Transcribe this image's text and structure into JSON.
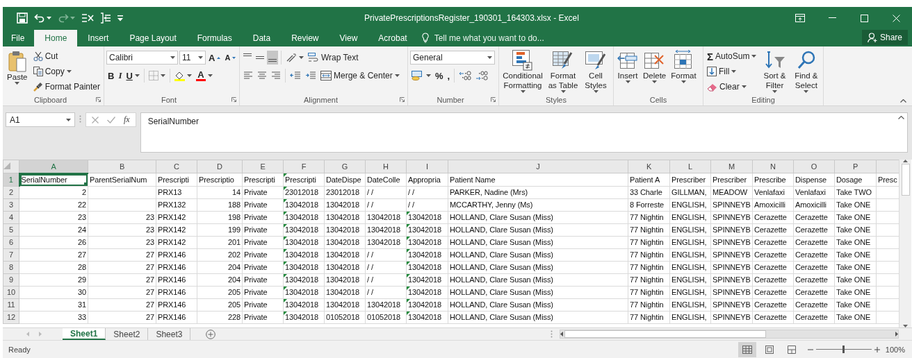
{
  "window": {
    "title": "PrivatePrescriptionsRegister_190301_164303.xlsx - Excel"
  },
  "quick_access": [
    {
      "kind": "save",
      "disabled": false
    },
    {
      "kind": "undo",
      "disabled": false
    },
    {
      "kind": "redo",
      "disabled": true
    },
    {
      "kind": "list-x",
      "disabled": false
    },
    {
      "kind": "list-arrow",
      "disabled": false
    },
    {
      "kind": "customize",
      "disabled": false
    }
  ],
  "tabs": [
    {
      "label": "File",
      "selected": false
    },
    {
      "label": "Home",
      "selected": true
    },
    {
      "label": "Insert",
      "selected": false
    },
    {
      "label": "Page Layout",
      "selected": false
    },
    {
      "label": "Formulas",
      "selected": false
    },
    {
      "label": "Data",
      "selected": false
    },
    {
      "label": "Review",
      "selected": false
    },
    {
      "label": "View",
      "selected": false
    },
    {
      "label": "Acrobat",
      "selected": false
    }
  ],
  "tell_me": {
    "placeholder": "Tell me what you want to do..."
  },
  "share_button": "Share",
  "ribbon": {
    "groups": [
      {
        "kind": "clipboard",
        "label": "Clipboard",
        "launcher": true,
        "paste": "Paste",
        "cut": "Cut",
        "copy": "Copy",
        "format_painter": "Format Painter"
      },
      {
        "kind": "font",
        "label": "Font",
        "launcher": true,
        "font_name": "Calibri",
        "font_size": "11",
        "grow": "A",
        "shrink": "A",
        "bold": "B",
        "italic": "I",
        "underline": "U",
        "font_color": "A"
      },
      {
        "kind": "alignment",
        "label": "Alignment",
        "launcher": true,
        "vertical": [
          {
            "kind": "top",
            "selected": false
          },
          {
            "kind": "middle",
            "selected": false
          },
          {
            "kind": "bottom",
            "selected": true
          }
        ],
        "wrap_text": "Wrap Text",
        "merge_center": "Merge & Center"
      },
      {
        "kind": "number",
        "label": "Number",
        "launcher": true,
        "format": "General",
        "percent": "%",
        "comma": ","
      },
      {
        "kind": "styles",
        "label": "Styles",
        "launcher": false,
        "buttons": [
          {
            "kind": "conditional",
            "label": "Conditional Formatting"
          },
          {
            "kind": "table",
            "label": "Format as Table"
          },
          {
            "kind": "cell-styles",
            "label": "Cell Styles"
          }
        ]
      },
      {
        "kind": "cells",
        "label": "Cells",
        "launcher": false,
        "buttons": [
          {
            "kind": "insert",
            "label": "Insert"
          },
          {
            "kind": "delete",
            "label": "Delete"
          },
          {
            "kind": "format",
            "label": "Format"
          }
        ]
      },
      {
        "kind": "editing",
        "label": "Editing",
        "launcher": false,
        "autosum_symbol": "Σ",
        "autosum": "AutoSum",
        "fill": "Fill",
        "clear": "Clear",
        "sort_filter": "Sort & Filter",
        "find_select": "Find & Select"
      }
    ]
  },
  "formula_bar": {
    "name_box": "A1",
    "function_symbol": "fx",
    "content": "SerialNumber"
  },
  "sheet": {
    "columns": [
      {
        "letter": "A",
        "selected": true,
        "numeric": true
      },
      {
        "letter": "B",
        "selected": false,
        "numeric": true
      },
      {
        "letter": "C",
        "selected": false,
        "numeric": false
      },
      {
        "letter": "D",
        "selected": false,
        "numeric": true
      },
      {
        "letter": "E",
        "selected": false,
        "numeric": false
      },
      {
        "letter": "F",
        "selected": false,
        "numeric": false
      },
      {
        "letter": "G",
        "selected": false,
        "numeric": false
      },
      {
        "letter": "H",
        "selected": false,
        "numeric": false
      },
      {
        "letter": "I",
        "selected": false,
        "numeric": false
      },
      {
        "letter": "J",
        "selected": false,
        "numeric": false
      },
      {
        "letter": "K",
        "selected": false,
        "numeric": false
      },
      {
        "letter": "L",
        "selected": false,
        "numeric": false
      },
      {
        "letter": "M",
        "selected": false,
        "numeric": false
      },
      {
        "letter": "N",
        "selected": false,
        "numeric": false
      },
      {
        "letter": "O",
        "selected": false,
        "numeric": false
      },
      {
        "letter": "P",
        "selected": false,
        "numeric": false
      },
      {
        "selected": false
      }
    ],
    "rows": [
      {
        "number": "1",
        "kind": "field-names",
        "selected": true,
        "cells": [
          "SerialNumber",
          "ParentSerialNum",
          "Prescripti",
          "Prescriptio",
          "Prescripti",
          "Prescripti",
          "DateDispe",
          "DateColle",
          "Appropria",
          "Patient Name",
          "Patient A",
          "Prescriber",
          "Prescriber",
          "Prescribe",
          "Dispense",
          "Dosage",
          "Presc"
        ],
        "flags": [
          false,
          false,
          false,
          false,
          false,
          true,
          false,
          false,
          false,
          false,
          false,
          false,
          false,
          false,
          false,
          false,
          false
        ]
      },
      {
        "number": "2",
        "kind": "record",
        "selected": false,
        "cells": [
          "2",
          null,
          "PRX13",
          "14",
          "Private",
          "23012018",
          "23012018",
          "/ /",
          "/ /",
          "PARKER, Nadine (Mrs)",
          "33 Charle",
          "GILLMAN,",
          "MEADOW",
          "Venlafaxi",
          "Venlafaxi",
          "Take TWO",
          null
        ],
        "flags": [
          false,
          false,
          false,
          false,
          false,
          true,
          false,
          false,
          false,
          false,
          false,
          false,
          false,
          false,
          false,
          false,
          false
        ]
      },
      {
        "number": "3",
        "kind": "record",
        "selected": false,
        "cells": [
          "22",
          null,
          "PRX132",
          "188",
          "Private",
          "13042018",
          "13042018",
          "/ /",
          "/ /",
          "MCCARTHY, Jenny (Ms)",
          "8 Forreste",
          "ENGLISH,",
          "SPINNEYB",
          "Amoxicilli",
          "Amoxicilli",
          "Take ONE",
          null
        ],
        "flags": [
          false,
          false,
          false,
          false,
          false,
          true,
          false,
          false,
          false,
          false,
          false,
          false,
          false,
          false,
          false,
          false,
          false
        ]
      },
      {
        "number": "4",
        "kind": "record",
        "selected": false,
        "cells": [
          "23",
          "23",
          "PRX142",
          "198",
          "Private",
          "13042018",
          "13042018",
          "13042018",
          "13042018",
          "HOLLAND, Clare Susan (Miss)",
          "77 Nightin",
          "ENGLISH,",
          "SPINNEYB",
          "Cerazette",
          "Cerazette",
          "Take ONE",
          null
        ],
        "flags": [
          false,
          false,
          false,
          false,
          false,
          true,
          false,
          false,
          true,
          false,
          false,
          false,
          false,
          false,
          false,
          false,
          false
        ]
      },
      {
        "number": "5",
        "kind": "record",
        "selected": false,
        "cells": [
          "24",
          "23",
          "PRX142",
          "199",
          "Private",
          "13042018",
          "13042018",
          "13042018",
          "13042018",
          "HOLLAND, Clare Susan (Miss)",
          "77 Nightin",
          "ENGLISH,",
          "SPINNEYB",
          "Cerazette",
          "Cerazette",
          "Take ONE",
          null
        ],
        "flags": [
          false,
          false,
          false,
          false,
          false,
          true,
          false,
          false,
          true,
          false,
          false,
          false,
          false,
          false,
          false,
          false,
          false
        ]
      },
      {
        "number": "6",
        "kind": "record",
        "selected": false,
        "cells": [
          "26",
          "23",
          "PRX142",
          "201",
          "Private",
          "13042018",
          "13042018",
          "13042018",
          "13042018",
          "HOLLAND, Clare Susan (Miss)",
          "77 Nightin",
          "ENGLISH,",
          "SPINNEYB",
          "Cerazette",
          "Cerazette",
          "Take ONE",
          null
        ],
        "flags": [
          false,
          false,
          false,
          false,
          false,
          true,
          false,
          false,
          true,
          false,
          false,
          false,
          false,
          false,
          false,
          false,
          false
        ]
      },
      {
        "number": "7",
        "kind": "record",
        "selected": false,
        "cells": [
          "27",
          "27",
          "PRX146",
          "202",
          "Private",
          "13042018",
          "13042018",
          "/ /",
          "13042018",
          "HOLLAND, Clare Susan (Miss)",
          "77 Nightin",
          "ENGLISH,",
          "SPINNEYB",
          "Cerazette",
          "Cerazette",
          "Take ONE",
          null
        ],
        "flags": [
          false,
          false,
          false,
          false,
          false,
          true,
          false,
          false,
          true,
          false,
          false,
          false,
          false,
          false,
          false,
          false,
          false
        ]
      },
      {
        "number": "8",
        "kind": "record",
        "selected": false,
        "cells": [
          "28",
          "27",
          "PRX146",
          "204",
          "Private",
          "13042018",
          "13042018",
          "/ /",
          "13042018",
          "HOLLAND, Clare Susan (Miss)",
          "77 Nightin",
          "ENGLISH,",
          "SPINNEYB",
          "Cerazette",
          "Cerazette",
          "Take ONE",
          null
        ],
        "flags": [
          false,
          false,
          false,
          false,
          false,
          true,
          false,
          false,
          true,
          false,
          false,
          false,
          false,
          false,
          false,
          false,
          false
        ]
      },
      {
        "number": "9",
        "kind": "record",
        "selected": false,
        "cells": [
          "29",
          "27",
          "PRX146",
          "204",
          "Private",
          "13042018",
          "13042018",
          "/ /",
          "13042018",
          "HOLLAND, Clare Susan (Miss)",
          "77 Nightin",
          "ENGLISH,",
          "SPINNEYB",
          "Cerazette",
          "Cerazette",
          "Take ONE",
          null
        ],
        "flags": [
          false,
          false,
          false,
          false,
          false,
          true,
          false,
          false,
          true,
          false,
          false,
          false,
          false,
          false,
          false,
          false,
          false
        ]
      },
      {
        "number": "10",
        "kind": "record",
        "selected": false,
        "cells": [
          "30",
          "27",
          "PRX146",
          "205",
          "Private",
          "13042018",
          "13042018",
          "/ /",
          "13042018",
          "HOLLAND, Clare Susan (Miss)",
          "77 Nightin",
          "ENGLISH,",
          "SPINNEYB",
          "Cerazette",
          "Cerazette",
          "Take ONE",
          null
        ],
        "flags": [
          false,
          false,
          false,
          false,
          false,
          true,
          false,
          false,
          true,
          false,
          false,
          false,
          false,
          false,
          false,
          false,
          false
        ]
      },
      {
        "number": "11",
        "kind": "record",
        "selected": false,
        "cells": [
          "31",
          "27",
          "PRX146",
          "205",
          "Private",
          "13042018",
          "13042018",
          "13042018",
          "13042018",
          "HOLLAND, Clare Susan (Miss)",
          "77 Nightin",
          "ENGLISH,",
          "SPINNEYB",
          "Cerazette",
          "Cerazette",
          "Take ONE",
          null
        ],
        "flags": [
          false,
          false,
          false,
          false,
          false,
          true,
          false,
          false,
          true,
          false,
          false,
          false,
          false,
          false,
          false,
          false,
          false
        ]
      },
      {
        "number": "12",
        "kind": "record",
        "selected": false,
        "cells": [
          "33",
          "27",
          "PRX146",
          "228",
          "Private",
          "13042018",
          "01052018",
          "01052018",
          "13042018",
          "HOLLAND, Clare Susan (Miss)",
          "77 Nightin",
          "ENGLISH,",
          "SPINNEYB",
          "Cerazette",
          "Cerazette",
          "Take ONE",
          null
        ],
        "flags": [
          false,
          false,
          false,
          false,
          false,
          true,
          false,
          false,
          true,
          false,
          false,
          false,
          false,
          false,
          false,
          false,
          false
        ]
      }
    ]
  },
  "sheet_tabs": [
    {
      "label": "Sheet1",
      "selected": true
    },
    {
      "label": "Sheet2",
      "selected": false
    },
    {
      "label": "Sheet3",
      "selected": false
    }
  ],
  "status_bar": {
    "status": "Ready",
    "views": [
      {
        "kind": "normal",
        "selected": true
      },
      {
        "kind": "page-layout",
        "selected": false
      },
      {
        "kind": "page-break",
        "selected": false
      }
    ],
    "zoom": {
      "level": 0.5,
      "reading": "100%"
    }
  }
}
